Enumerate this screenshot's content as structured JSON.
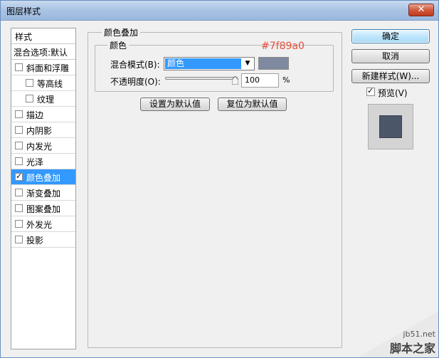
{
  "window": {
    "title": "图层样式",
    "close_glyph": "✕"
  },
  "sidebar": {
    "header": "样式",
    "blend_options": "混合选项:默认",
    "items": [
      {
        "label": "斜面和浮雕",
        "checked": false,
        "indent": false,
        "active": false
      },
      {
        "label": "等高线",
        "checked": false,
        "indent": true,
        "active": false
      },
      {
        "label": "纹理",
        "checked": false,
        "indent": true,
        "active": false
      },
      {
        "label": "描边",
        "checked": false,
        "indent": false,
        "active": false
      },
      {
        "label": "内阴影",
        "checked": false,
        "indent": false,
        "active": false
      },
      {
        "label": "内发光",
        "checked": false,
        "indent": false,
        "active": false
      },
      {
        "label": "光泽",
        "checked": false,
        "indent": false,
        "active": false
      },
      {
        "label": "颜色叠加",
        "checked": true,
        "indent": false,
        "active": true
      },
      {
        "label": "渐变叠加",
        "checked": false,
        "indent": false,
        "active": false
      },
      {
        "label": "图案叠加",
        "checked": false,
        "indent": false,
        "active": false
      },
      {
        "label": "外发光",
        "checked": false,
        "indent": false,
        "active": false
      },
      {
        "label": "投影",
        "checked": false,
        "indent": false,
        "active": false
      }
    ]
  },
  "main": {
    "group_title": "颜色叠加",
    "subgroup_title": "颜色",
    "hex_annotation": "#7f89a0",
    "blend_mode_label": "混合模式(B):",
    "blend_mode_value": "颜色",
    "overlay_color": "#7f89a0",
    "opacity_label": "不透明度(O):",
    "opacity_value": "100",
    "opacity_fraction": 1.0,
    "opacity_unit": "%",
    "set_default_button": "设置为默认值",
    "reset_default_button": "复位为默认值"
  },
  "actions": {
    "ok": "确定",
    "cancel": "取消",
    "new_style": "新建样式(W)...",
    "preview_label": "预览(V)",
    "preview_checked": true,
    "preview_color": "#4c5669"
  },
  "watermark": {
    "site": "jb51.net",
    "brand": "脚本之家"
  },
  "colors": {
    "selection": "#3399ff",
    "annotation": "#e8503f"
  },
  "icons": {
    "close": "close-icon",
    "dropdown": "chevron-down-icon",
    "slider": "slider-thumb-icon",
    "check": "checkmark-icon"
  }
}
